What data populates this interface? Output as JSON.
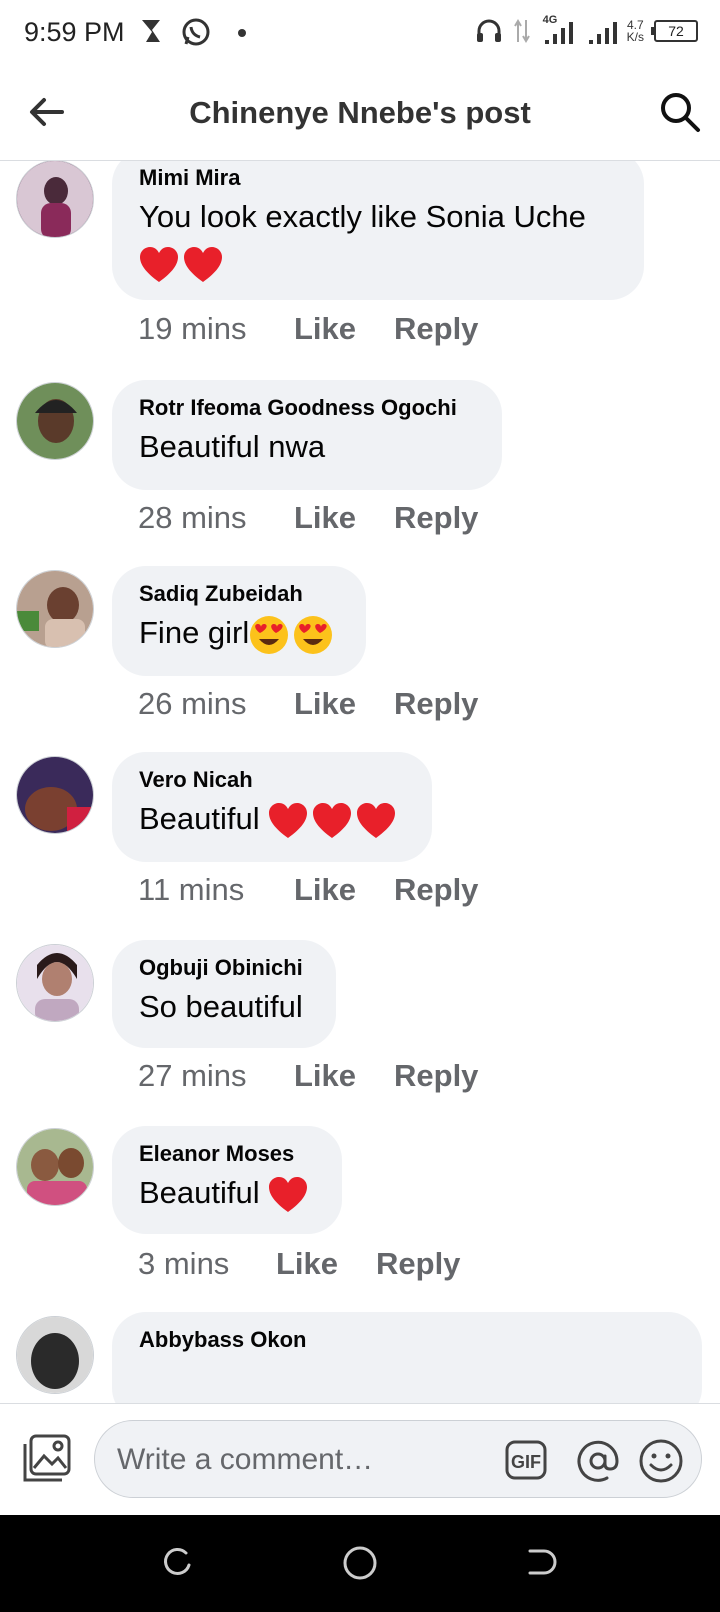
{
  "status_bar": {
    "time": "9:59 PM",
    "network": "4G",
    "speed_value": "4.7",
    "speed_unit": "K/s",
    "battery": "72"
  },
  "header": {
    "title": "Chinenye Nnebe's post"
  },
  "comments": [
    {
      "name": "Mimi Mira",
      "text": "You look exactly like Sonia Uche",
      "emojis": [
        "heart",
        "heart"
      ],
      "emoji_line": "second",
      "time": "19 mins",
      "like": "Like",
      "reply": "Reply",
      "avatar_color": "#7d4a6a"
    },
    {
      "name": "Rotr Ifeoma Goodness Ogochi",
      "text": "Beautiful nwa",
      "emojis": [],
      "time": "28 mins",
      "like": "Like",
      "reply": "Reply",
      "avatar_color": "#5c7a4a"
    },
    {
      "name": "Sadiq Zubeidah",
      "text": "Fine girl",
      "emojis": [
        "heart-eyes",
        "heart-eyes"
      ],
      "time": "26 mins",
      "like": "Like",
      "reply": "Reply",
      "avatar_color": "#8b6a5a"
    },
    {
      "name": "Vero Nicah",
      "text": "Beautiful",
      "emojis": [
        "heart",
        "heart",
        "heart"
      ],
      "time": "11 mins",
      "like": "Like",
      "reply": "Reply",
      "avatar_color": "#6a3e3a"
    },
    {
      "name": "Ogbuji Obinichi",
      "text": "So beautiful",
      "emojis": [],
      "time": "27 mins",
      "like": "Like",
      "reply": "Reply",
      "avatar_color": "#c9b8c8"
    },
    {
      "name": "Eleanor Moses",
      "text": "Beautiful",
      "emojis": [
        "heart"
      ],
      "time": "3 mins",
      "like": "Like",
      "reply": "Reply",
      "avatar_color": "#8a7a5a"
    },
    {
      "name": "Abbybass Okon",
      "text": "",
      "emojis": [],
      "time": "",
      "like": "",
      "reply": "",
      "avatar_color": "#2a2a2a"
    }
  ],
  "composer": {
    "placeholder": "Write a comment…",
    "gif_label": "GIF"
  },
  "colors": {
    "bubble": "#f0f2f5",
    "secondary_text": "#65676b",
    "heart": "#e8202a"
  }
}
